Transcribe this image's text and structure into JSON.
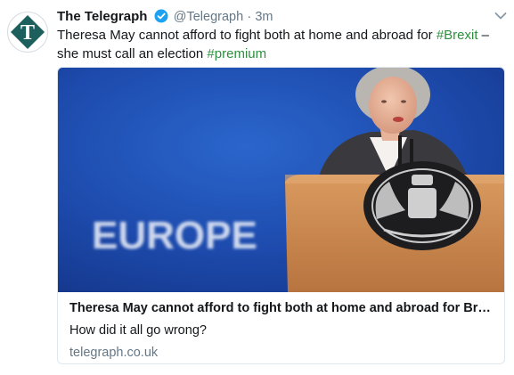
{
  "account": {
    "name": "The Telegraph",
    "handle": "@Telegraph",
    "dot": "·",
    "time": "3m"
  },
  "tweet": {
    "text_part1": "Theresa May cannot afford to fight both at home and abroad for ",
    "hashtag1": "#Brexit",
    "text_part2": " – she must call an election ",
    "hashtag2": "#premium"
  },
  "card": {
    "title": "Theresa May cannot afford to fight both at home and abroad for Brex...",
    "description": "How did it all go wrong?",
    "domain": "telegraph.co.uk",
    "image_sign_text": "EUROPE"
  },
  "icons": {
    "avatar": "telegraph-logo-icon",
    "verified": "verified-badge-icon",
    "menu": "chevron-down-icon"
  },
  "colors": {
    "hashtag": "#2f8f3e",
    "verified": "#1da1f2",
    "secondary_text": "#657786",
    "logo": "#1c5f5c"
  }
}
